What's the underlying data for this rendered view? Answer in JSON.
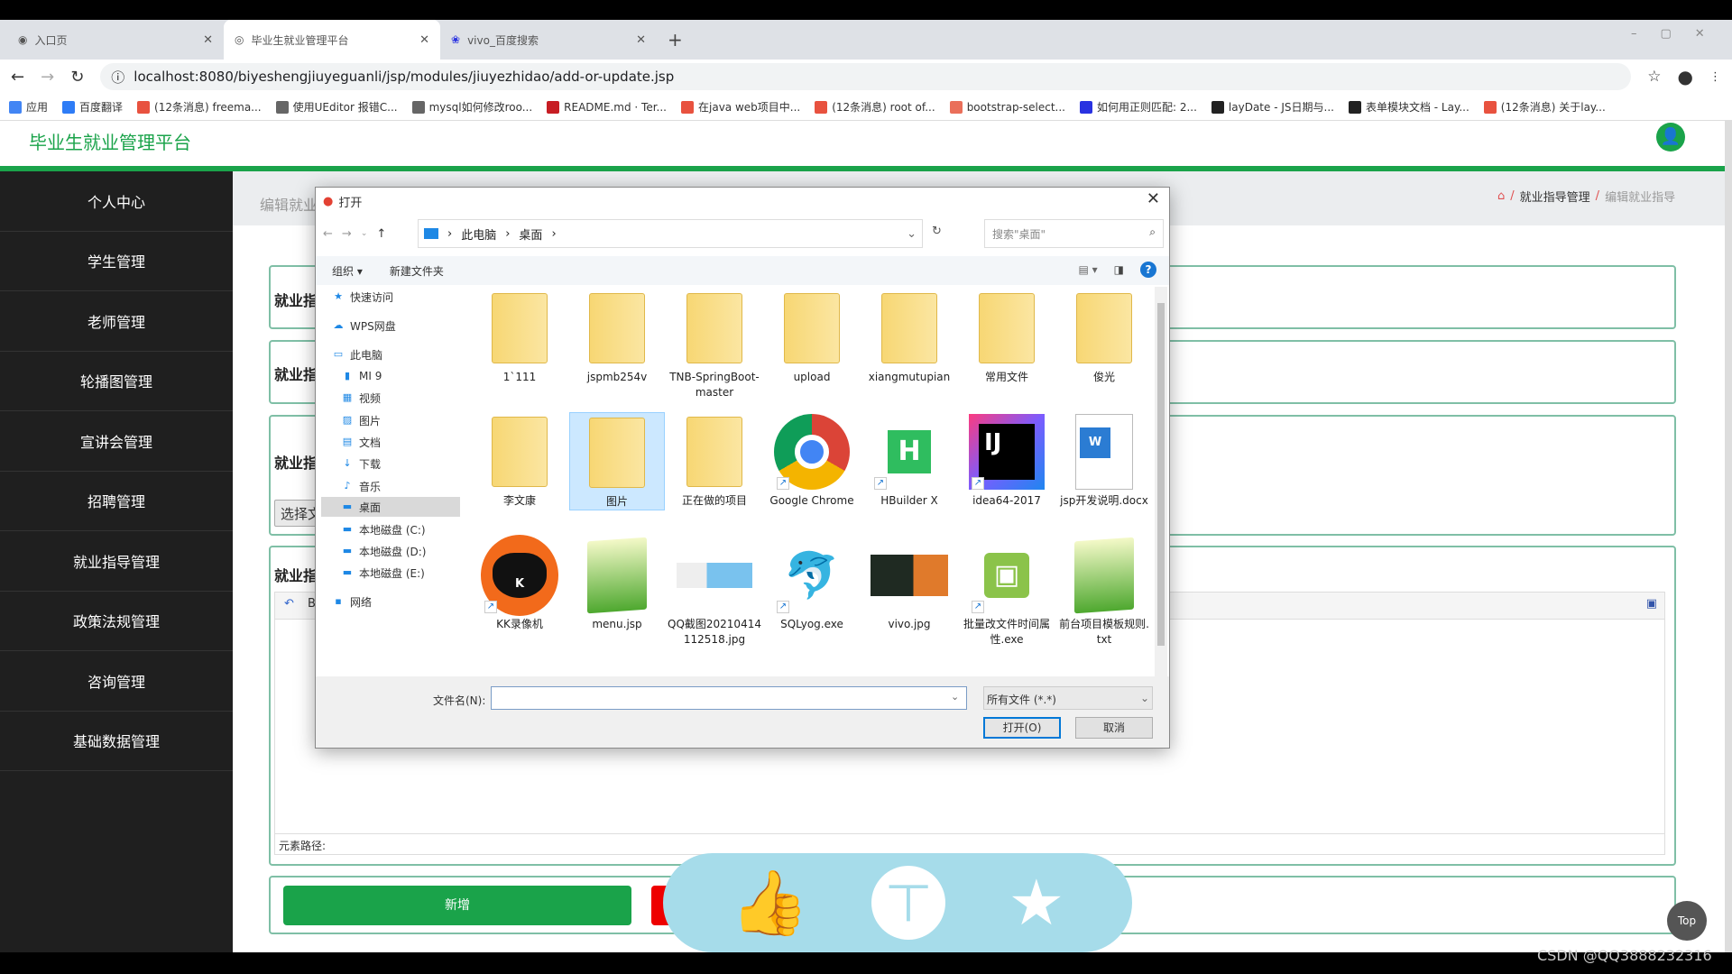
{
  "browser": {
    "tabs": [
      {
        "label": "入口页",
        "active": false
      },
      {
        "label": "毕业生就业管理平台",
        "active": true
      },
      {
        "label": "vivo_百度搜索",
        "active": false
      }
    ],
    "url": "localhost:8080/biyeshengjiuyeguanli/jsp/modules/jiuyezhidao/add-or-update.jsp",
    "bookmarks": [
      {
        "label": "应用",
        "icon": "apps-icon",
        "color": "#4285f4"
      },
      {
        "label": "百度翻译",
        "icon": "baidu-translate-icon",
        "color": "#2e7cf6"
      },
      {
        "label": "(12条消息) freema...",
        "icon": "csdn-icon",
        "color": "#e8523f"
      },
      {
        "label": "使用UEditor 报错C...",
        "icon": "link-icon",
        "color": "#666666"
      },
      {
        "label": "mysql如何修改roo...",
        "icon": "link-icon",
        "color": "#666666"
      },
      {
        "label": "README.md · Ter...",
        "icon": "gitee-icon",
        "color": "#c71d23"
      },
      {
        "label": "在java web项目中...",
        "icon": "csdn-icon",
        "color": "#e8523f"
      },
      {
        "label": "(12条消息) root of...",
        "icon": "csdn-icon",
        "color": "#e8523f"
      },
      {
        "label": "bootstrap-select...",
        "icon": "jianshu-icon",
        "color": "#ea6f5a"
      },
      {
        "label": "如何用正则匹配: 2...",
        "icon": "baidu-icon",
        "color": "#2932e1"
      },
      {
        "label": "layDate - JS日期与...",
        "icon": "layui-icon",
        "color": "#222222"
      },
      {
        "label": "表单模块文档 - Lay...",
        "icon": "layui-icon",
        "color": "#222222"
      },
      {
        "label": "(12条消息) 关于lay...",
        "icon": "csdn-icon",
        "color": "#e8523f"
      }
    ]
  },
  "app": {
    "title": "毕业生就业管理平台",
    "accent": "#1aa34a",
    "sidebar": [
      "个人中心",
      "学生管理",
      "老师管理",
      "轮播图管理",
      "宣讲会管理",
      "招聘管理",
      "就业指导管理",
      "政策法规管理",
      "咨询管理",
      "基础数据管理"
    ],
    "page_title": "编辑就业",
    "breadcrumb": [
      "就业指导管理",
      "编辑就业指导"
    ],
    "form_labels": [
      "就业指",
      "就业指",
      "就业指",
      "就业指"
    ],
    "choose_button": "选择文",
    "editor_toolbar_first": "B",
    "editor_path": "元素路径:",
    "add_button": "新增",
    "top_button": "Top",
    "watermark": "CSDN @QQ3888232316"
  },
  "dialog": {
    "title": "打开",
    "path": [
      "此电脑",
      "桌面"
    ],
    "search_placeholder": "搜索\"桌面\"",
    "organize": "组织 ▾",
    "new_folder": "新建文件夹",
    "nav": [
      {
        "label": "快速访问",
        "icon": "star-icon"
      },
      {
        "label": "WPS网盘",
        "icon": "cloud-icon"
      },
      {
        "label": "此电脑",
        "icon": "computer-icon"
      },
      {
        "label": "MI 9",
        "icon": "phone-icon"
      },
      {
        "label": "视频",
        "icon": "video-icon"
      },
      {
        "label": "图片",
        "icon": "picture-icon"
      },
      {
        "label": "文档",
        "icon": "document-icon"
      },
      {
        "label": "下载",
        "icon": "download-icon"
      },
      {
        "label": "音乐",
        "icon": "music-icon"
      },
      {
        "label": "桌面",
        "icon": "desktop-icon",
        "selected": true
      },
      {
        "label": "本地磁盘 (C:)",
        "icon": "drive-icon"
      },
      {
        "label": "本地磁盘 (D:)",
        "icon": "drive-icon"
      },
      {
        "label": "本地磁盘 (E:)",
        "icon": "drive-icon"
      },
      {
        "label": "网络",
        "icon": "network-icon"
      }
    ],
    "files": [
      {
        "name": "1`111",
        "type": "folder"
      },
      {
        "name": "jspmb254v",
        "type": "folder"
      },
      {
        "name": "TNB-SpringBoot-master",
        "type": "folder"
      },
      {
        "name": "upload",
        "type": "folder"
      },
      {
        "name": "xiangmutupian",
        "type": "folder"
      },
      {
        "name": "常用文件",
        "type": "folder"
      },
      {
        "name": "俊光",
        "type": "folder"
      },
      {
        "name": "李文康",
        "type": "folder"
      },
      {
        "name": "图片",
        "type": "folder",
        "selected": true
      },
      {
        "name": "正在做的项目",
        "type": "folder"
      },
      {
        "name": "Google Chrome",
        "type": "chrome",
        "shortcut": true
      },
      {
        "name": "HBuilder X",
        "type": "hbuilder",
        "shortcut": true
      },
      {
        "name": "idea64-2017",
        "type": "idea",
        "shortcut": true
      },
      {
        "name": "jsp开发说明.docx",
        "type": "word"
      },
      {
        "name": "KK录像机",
        "type": "kk",
        "shortcut": true
      },
      {
        "name": "menu.jsp",
        "type": "notepad"
      },
      {
        "name": "QQ截图20210414112518.jpg",
        "type": "image"
      },
      {
        "name": "SQLyog.exe",
        "type": "sqlyog",
        "shortcut": true
      },
      {
        "name": "vivo.jpg",
        "type": "photo"
      },
      {
        "name": "批量改文件时间属性.exe",
        "type": "android",
        "shortcut": true
      },
      {
        "name": "前台项目模板规则.txt",
        "type": "notepad"
      }
    ],
    "filename_label": "文件名(N):",
    "filename_value": "",
    "filetype": "所有文件 (*.*)",
    "open_button": "打开(O)",
    "cancel_button": "取消"
  }
}
